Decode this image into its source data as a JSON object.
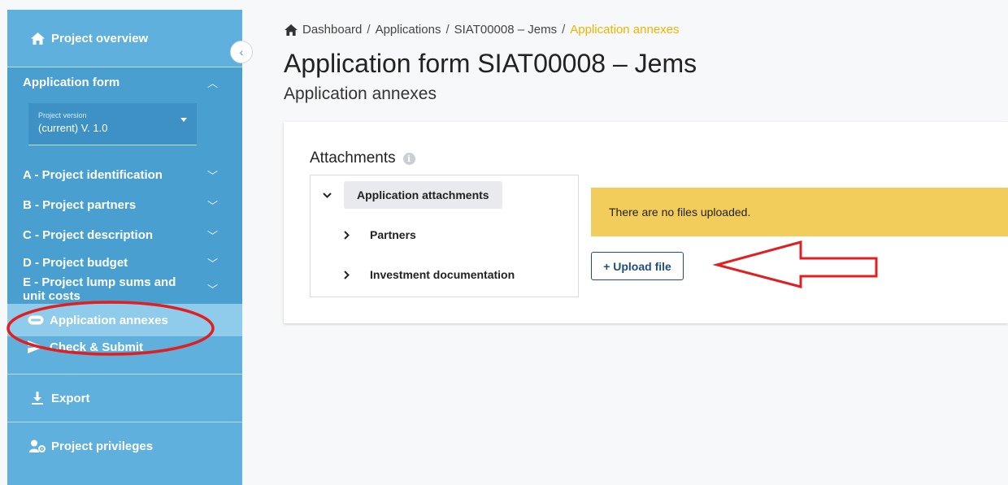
{
  "sidebar": {
    "project_overview": "Project overview",
    "application_form": "Application form",
    "version_label": "Project version",
    "version_value": "(current) V. 1.0",
    "sections": [
      {
        "label": "A - Project identification"
      },
      {
        "label": "B - Project partners"
      },
      {
        "label": "C - Project description"
      },
      {
        "label": "D - Project budget"
      },
      {
        "label_line1": "E - Project lump sums and",
        "label_line2": "unit costs"
      }
    ],
    "application_annexes": "Application annexes",
    "check_submit": "Check & Submit",
    "export": "Export",
    "project_privileges": "Project privileges"
  },
  "breadcrumb": {
    "dashboard": "Dashboard",
    "applications": "Applications",
    "project": "SIAT00008 – Jems",
    "current": "Application annexes",
    "separator": "/"
  },
  "page": {
    "title": "Application form SIAT00008 – Jems",
    "subtitle": "Application annexes"
  },
  "attachments": {
    "title": "Attachments",
    "tree": {
      "root": "Application attachments",
      "children": [
        "Partners",
        "Investment documentation"
      ]
    },
    "notice": "There are no files uploaded.",
    "upload_button": "+ Upload file"
  },
  "icons": {
    "home": "home-icon",
    "collapse": "chevron-left-icon",
    "attachment": "paperclip-icon",
    "send": "send-icon",
    "download": "download-icon",
    "privileges": "user-gear-icon",
    "info": "info-icon"
  },
  "colors": {
    "sidebar": "#5fb0dc",
    "sidebar_group": "#4a9fd1",
    "sidebar_active": "#8fcbea",
    "breadcrumb_active": "#f0b400",
    "notice": "#f3cd5c",
    "button_border": "#1f4e79",
    "annotation_red": "#e02020"
  }
}
